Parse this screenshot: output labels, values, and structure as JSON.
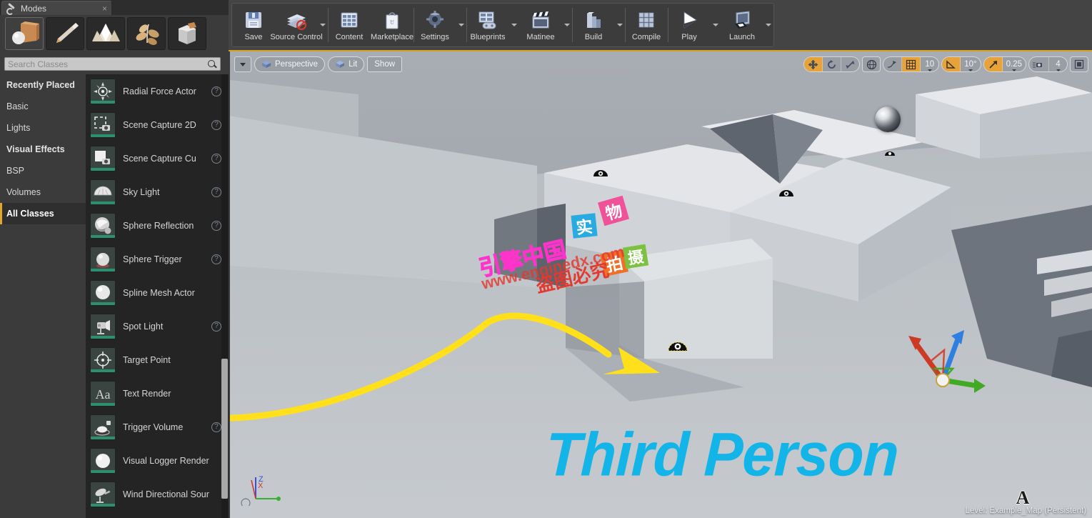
{
  "window": {
    "modes_tab_label": "Modes",
    "tab_close": "×"
  },
  "mode_buttons": [
    {
      "name": "place-mode",
      "icon": "box-sphere-icon",
      "active": true
    },
    {
      "name": "paint-mode",
      "icon": "paintbrush-icon",
      "active": false
    },
    {
      "name": "landscape-mode",
      "icon": "mountain-icon",
      "active": false
    },
    {
      "name": "foliage-mode",
      "icon": "leaf-icon",
      "active": false
    },
    {
      "name": "geometry-mode",
      "icon": "geometry-box-icon",
      "active": false
    }
  ],
  "search": {
    "placeholder": "Search Classes",
    "value": ""
  },
  "categories": [
    {
      "label": "Recently Placed",
      "bold": true,
      "selected": false
    },
    {
      "label": "Basic",
      "bold": false,
      "selected": false
    },
    {
      "label": "Lights",
      "bold": false,
      "selected": false
    },
    {
      "label": "Visual Effects",
      "bold": true,
      "selected": false
    },
    {
      "label": "BSP",
      "bold": false,
      "selected": false
    },
    {
      "label": "Volumes",
      "bold": false,
      "selected": false
    },
    {
      "label": "All Classes",
      "bold": true,
      "selected": true
    }
  ],
  "class_list": [
    {
      "label": "Radial Force Actor",
      "icon": "radial-force-icon",
      "help": true
    },
    {
      "label": "Scene Capture 2D",
      "icon": "scene-capture-2d-icon",
      "help": true
    },
    {
      "label": "Scene Capture Cu",
      "icon": "scene-capture-cube-icon",
      "help": true
    },
    {
      "label": "Sky Light",
      "icon": "sky-light-icon",
      "help": true
    },
    {
      "label": "Sphere Reflection",
      "icon": "sphere-reflection-icon",
      "help": true
    },
    {
      "label": "Sphere Trigger",
      "icon": "sphere-trigger-icon",
      "help": true
    },
    {
      "label": "Spline Mesh Actor",
      "icon": "spline-mesh-icon",
      "help": false
    },
    {
      "label": "Spot Light",
      "icon": "spot-light-icon",
      "help": true
    },
    {
      "label": "Target Point",
      "icon": "target-point-icon",
      "help": false
    },
    {
      "label": "Text Render",
      "icon": "text-render-icon",
      "help": false
    },
    {
      "label": "Trigger Volume",
      "icon": "trigger-volume-icon",
      "help": true
    },
    {
      "label": "Visual Logger Render",
      "icon": "visual-logger-icon",
      "help": false
    },
    {
      "label": "Wind Directional Sour",
      "icon": "wind-directional-icon",
      "help": false
    }
  ],
  "toolbar": {
    "groups": [
      {
        "items": [
          {
            "label": "Save",
            "icon": "floppy-disk-icon",
            "arrow": false
          },
          {
            "label": "Source Control",
            "icon": "source-control-icon",
            "arrow": true
          }
        ]
      },
      {
        "items": [
          {
            "label": "Content",
            "icon": "content-browser-icon",
            "arrow": false
          },
          {
            "label": "Marketplace",
            "icon": "marketplace-bag-icon",
            "arrow": false
          }
        ]
      },
      {
        "items": [
          {
            "label": "Settings",
            "icon": "gear-icon",
            "arrow": true
          }
        ]
      },
      {
        "items": [
          {
            "label": "Blueprints",
            "icon": "blueprint-icon",
            "arrow": true
          },
          {
            "label": "Matinee",
            "icon": "clapperboard-icon",
            "arrow": true
          }
        ]
      },
      {
        "items": [
          {
            "label": "Build",
            "icon": "build-icon",
            "arrow": true
          }
        ]
      },
      {
        "items": [
          {
            "label": "Compile",
            "icon": "compile-cubes-icon",
            "arrow": false
          }
        ]
      },
      {
        "items": [
          {
            "label": "Play",
            "icon": "play-triangle-icon",
            "arrow": true
          },
          {
            "label": "Launch",
            "icon": "launch-device-icon",
            "arrow": true
          }
        ]
      }
    ]
  },
  "viewport": {
    "menu_caret": "viewport-options-caret",
    "view_mode_label": "Perspective",
    "lit_label": "Lit",
    "show_label": "Show",
    "transform_tools": [
      {
        "name": "translate-tool",
        "icon": "move-arrows-icon",
        "active": true
      },
      {
        "name": "rotate-tool",
        "icon": "rotate-icon",
        "active": false
      },
      {
        "name": "scale-tool",
        "icon": "scale-icon",
        "active": false
      }
    ],
    "coord_system": {
      "name": "world-coordinate-toggle",
      "icon": "globe-icon"
    },
    "surface_snap": {
      "name": "surface-snap-toggle",
      "icon": "surface-snap-icon",
      "active": false
    },
    "grid_snap": {
      "name": "grid-snap-toggle",
      "icon": "grid-icon",
      "active": true,
      "value": "10"
    },
    "rotation_snap": {
      "name": "rotation-snap-toggle",
      "icon": "angle-icon",
      "active": true,
      "value": "10°"
    },
    "scale_snap": {
      "name": "scale-snap-toggle",
      "icon": "scale-arrow-icon",
      "active": true,
      "value": "0.25"
    },
    "camera_speed": {
      "name": "camera-speed",
      "icon": "camera-speed-icon",
      "value": "4"
    },
    "maximize": {
      "name": "maximize-viewport-button",
      "icon": "maximize-icon"
    },
    "status_text": "Level:  Example_Map (Persistent)",
    "axis_labels": {
      "z": "Z",
      "x": "X",
      "y": "Y"
    },
    "scene_banner": "Third Person",
    "marker_letter": "A"
  },
  "watermarks": {
    "brand_cn": "引擎中国",
    "url": "www.enginedx.com",
    "notice": "盗图必究",
    "tiles": [
      {
        "text": "实",
        "color": "#29abe2"
      },
      {
        "text": "物",
        "color": "#f0529a"
      },
      {
        "text": "拍",
        "color": "#ef7129"
      },
      {
        "text": "摄",
        "color": "#7cc141"
      }
    ]
  },
  "annotation": {
    "arrow_name": "yellow-pointer-arrow",
    "color": "#ffe01b",
    "from": "Target Point",
    "to": "placed target point actor in scene"
  },
  "colors": {
    "accent_orange": "#e0a62e",
    "panel_bg": "#3b3b3b",
    "list_bg": "#242424",
    "toolbar_bg": "#444444",
    "viewport_sky": "#9ea3a8",
    "banner_cyan": "#13b5e8"
  }
}
